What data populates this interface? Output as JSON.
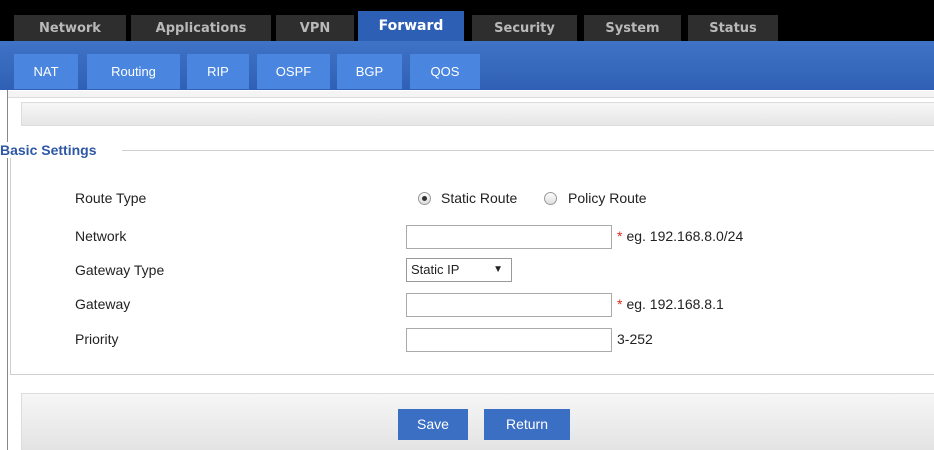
{
  "top_nav": {
    "tabs": [
      {
        "label": "Network",
        "active": false
      },
      {
        "label": "Applications",
        "active": false
      },
      {
        "label": "VPN",
        "active": false
      },
      {
        "label": "Forward",
        "active": true
      },
      {
        "label": "Security",
        "active": false
      },
      {
        "label": "System",
        "active": false
      },
      {
        "label": "Status",
        "active": false
      }
    ]
  },
  "sub_nav": {
    "tabs": [
      {
        "label": "NAT"
      },
      {
        "label": "Routing"
      },
      {
        "label": "RIP"
      },
      {
        "label": "OSPF"
      },
      {
        "label": "BGP"
      },
      {
        "label": "QOS"
      }
    ]
  },
  "basic_settings": {
    "legend": "Basic Settings",
    "route_type": {
      "label": "Route Type",
      "options": [
        "Static Route",
        "Policy Route"
      ],
      "selected": "Static Route"
    },
    "network": {
      "label": "Network",
      "value": "",
      "required_mark": "*",
      "hint": "eg. 192.168.8.0/24"
    },
    "gateway_type": {
      "label": "Gateway Type",
      "selected": "Static IP"
    },
    "gateway": {
      "label": "Gateway",
      "value": "",
      "required_mark": "*",
      "hint": "eg. 192.168.8.1"
    },
    "priority": {
      "label": "Priority",
      "value": "",
      "hint": "3-252"
    }
  },
  "actions": {
    "save_label": "Save",
    "return_label": "Return"
  },
  "colors": {
    "active_tab": "#2d5fb5",
    "sub_tab": "#4a86e0",
    "required": "#e0261b",
    "legend": "#2e57a6"
  }
}
